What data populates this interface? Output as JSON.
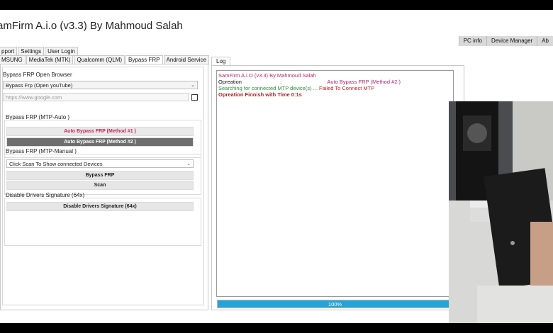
{
  "window": {
    "title": "amFirm A.i.o (v3.3) By Mahmoud Salah"
  },
  "top_right_tabs": [
    "PC info",
    "Device Manager",
    "Ab"
  ],
  "menu": [
    "pport",
    "Settings",
    "User Login"
  ],
  "tabs": [
    "MSUNG",
    "MediaTek (MTK)",
    "Qualcomm (QLM)",
    "Bypass FRP",
    "Android Service"
  ],
  "active_tab": "Bypass FRP",
  "browser_group": {
    "label": "Bypass FRP Open Browser",
    "selected": "Bypass Frp (Open youTube)",
    "url_placeholder": "https://www.google.com"
  },
  "mtp_auto": {
    "label": "Bypass FRP (MTP-Auto )",
    "method1": "Auto Bypass FRP (Method #1 )",
    "method2": "Auto Bypass FRP (Method #2 )"
  },
  "mtp_manual": {
    "label": "Bypass FRP (MTP-Manual )",
    "device_select": "Click Scan To Show connected Devices",
    "bypass_button": "Bypass FRP",
    "scan_button": "Scan"
  },
  "drivers": {
    "label": "Disable Drivers Signature (64x)",
    "button": "Disable Drivers Signature (64x)"
  },
  "log": {
    "tab": "Log",
    "lines": [
      {
        "text": "SamFirm A.i.O (v3.3) By Mahmoud Salah",
        "color": "#b5256b"
      },
      {
        "text": "Opreation                          :  ",
        "color": "#111111"
      },
      {
        "text": "Auto Bypass FRP (Method #2 )",
        "color": "#b5256b"
      },
      {
        "text": "Searching for connected MTP device(s) ... ",
        "color": "#2e8b3c"
      },
      {
        "text": "Failed To Connect MTP",
        "color": "#c02020"
      },
      {
        "text": "Opreation Finnish with Time 0:1s",
        "color": "#b02020"
      }
    ]
  },
  "progress": {
    "value": 100,
    "label": "100%",
    "color": "#24a3d6"
  },
  "accent_colors": {
    "method_text": "#c0285a",
    "progress": "#24a3d6"
  }
}
